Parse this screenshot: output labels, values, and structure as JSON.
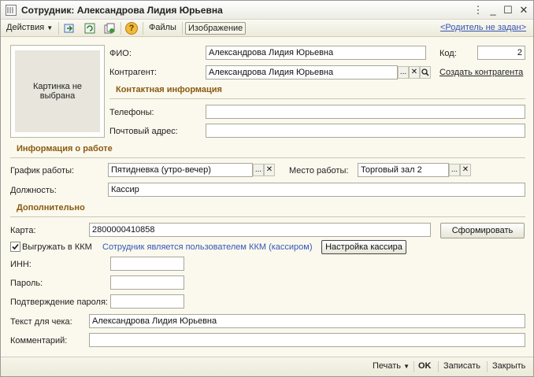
{
  "window": {
    "title": "Сотрудник: Александрова Лидия Юрьевна",
    "controls": [
      "⋮",
      "_",
      "☐",
      "✕"
    ]
  },
  "toolbar": {
    "actions_label": "Действия",
    "help_label": "?",
    "files_label": "Файлы",
    "image_label": "Изображение",
    "parent_link": "<Родитель не задан>"
  },
  "photo": {
    "text": "Картинка не выбрана"
  },
  "fio": {
    "label": "ФИО:",
    "value": "Александрова Лидия Юрьевна"
  },
  "code": {
    "label": "Код:",
    "value": "2"
  },
  "counterparty": {
    "label": "Контрагент:",
    "value": "Александрова Лидия Юрьевна",
    "create_link": "Создать контрагента",
    "btn_select": "...",
    "btn_clear": "✕"
  },
  "contact_section": "Контактная информация",
  "phones": {
    "label": "Телефоны:",
    "value": ""
  },
  "postal": {
    "label": "Почтовый адрес:",
    "value": ""
  },
  "work_section": "Информация о работе",
  "schedule": {
    "label": "График работы:",
    "value": "Пятидневка (утро-вечер)"
  },
  "workplace": {
    "label": "Место работы:",
    "value": "Торговый зал 2"
  },
  "position": {
    "label": "Должность:",
    "value": "Кассир"
  },
  "extra_section": "Дополнительно",
  "card": {
    "label": "Карта:",
    "value": "2800000410858",
    "generate_button": "Сформировать"
  },
  "kkm": {
    "checkbox_label": "Выгружать в ККМ",
    "checked": true,
    "cashier_link": "Сотрудник является пользователем ККМ (кассиром)",
    "settings_button": "Настройка кассира"
  },
  "inn": {
    "label": "ИНН:",
    "value": ""
  },
  "password": {
    "label": "Пароль:",
    "value": ""
  },
  "password_confirm": {
    "label": "Подтверждение пароля:",
    "value": ""
  },
  "receipt_text": {
    "label": "Текст для чека:",
    "value": "Александрова Лидия Юрьевна"
  },
  "comment": {
    "label": "Комментарий:",
    "value": ""
  },
  "footer": {
    "print_label": "Печать",
    "ok_label": "OK",
    "save_label": "Записать",
    "close_label": "Закрыть"
  }
}
